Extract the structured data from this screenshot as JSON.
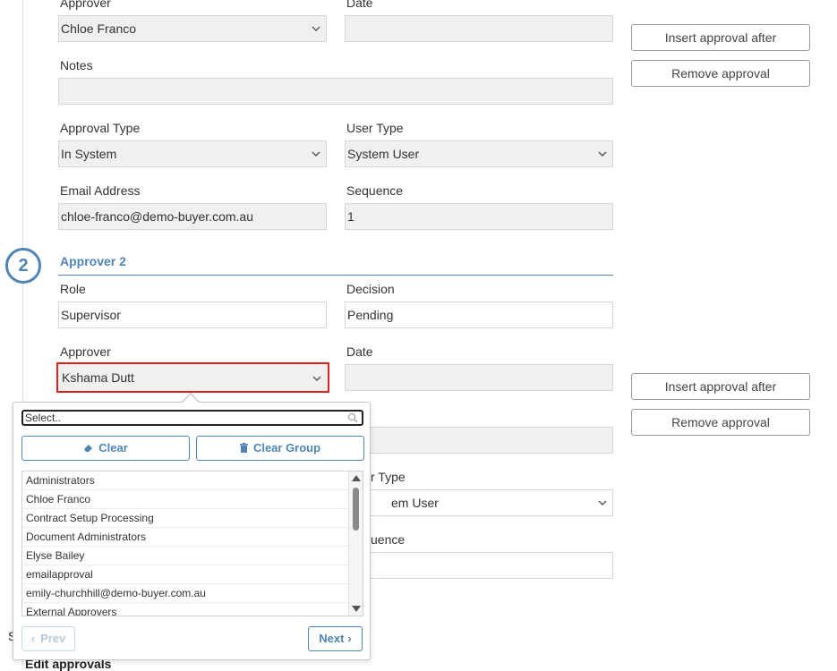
{
  "approver1": {
    "approver_label": "Approver",
    "date_label": "Date",
    "approver_value": "Chloe Franco",
    "date_value": "",
    "notes_label": "Notes",
    "notes_value": "",
    "approval_type_label": "Approval Type",
    "approval_type_value": "In System",
    "user_type_label": "User Type",
    "user_type_value": "System User",
    "email_label": "Email Address",
    "email_value": "chloe-franco@demo-buyer.com.au",
    "sequence_label": "Sequence",
    "sequence_value": "1",
    "insert_after_label": "Insert approval after",
    "remove_label": "Remove approval"
  },
  "approver2": {
    "step_number": "2",
    "title": "Approver 2",
    "role_label": "Role",
    "role_value": "Supervisor",
    "decision_label": "Decision",
    "decision_value": "Pending",
    "approver_label": "Approver",
    "approver_value": "Kshama Dutt",
    "date_label": "Date",
    "date_value": "",
    "user_type_label_partial": "r Type",
    "user_type_value_partial": "em User",
    "sequence_label_partial": "uence",
    "insert_after_label": "Insert approval after",
    "remove_label": "Remove approval"
  },
  "dropdown": {
    "search_placeholder": "Select..",
    "clear_label": "Clear",
    "clear_group_label": "Clear Group",
    "items": [
      "Administrators",
      "Chloe Franco",
      "Contract Setup Processing",
      "Document Administrators",
      "Elyse Bailey",
      "emailapproval",
      "emily-churchhill@demo-buyer.com.au",
      "External Approvers"
    ],
    "prev_label": "Prev",
    "next_label": "Next"
  },
  "footer": {
    "partial_s": "S",
    "edit_approvals": "Edit approvals"
  },
  "colors": {
    "accent": "#4f84b4",
    "focus_border": "#e02020",
    "field_bg": "#f0f0f0"
  }
}
